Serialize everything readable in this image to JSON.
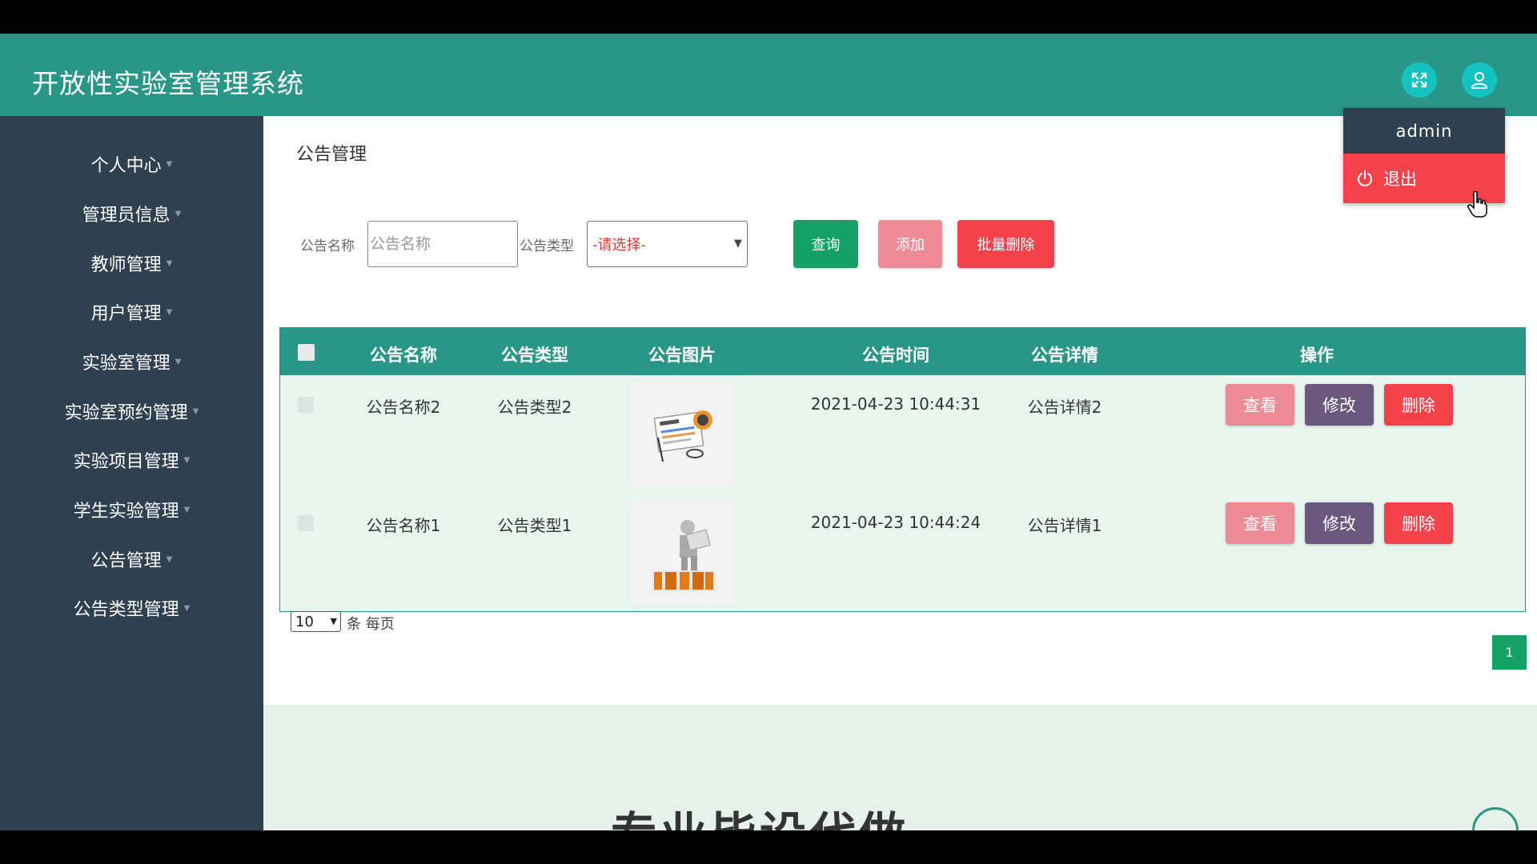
{
  "header": {
    "app_title": "开放性实验室管理系统",
    "colors": {
      "topbar": "#2a9688",
      "icon_button": "#14c2c2"
    },
    "icons": [
      "expand-icon",
      "user-icon"
    ]
  },
  "sidebar": {
    "items": [
      {
        "label": "个人中心"
      },
      {
        "label": "管理员信息"
      },
      {
        "label": "教师管理"
      },
      {
        "label": "用户管理"
      },
      {
        "label": "实验室管理"
      },
      {
        "label": "实验室预约管理"
      },
      {
        "label": "实验项目管理"
      },
      {
        "label": "学生实验管理"
      },
      {
        "label": "公告管理"
      },
      {
        "label": "公告类型管理"
      }
    ]
  },
  "page": {
    "title": "公告管理"
  },
  "search": {
    "name_label": "公告名称",
    "name_placeholder": "公告名称",
    "type_label": "公告类型",
    "type_selected": "-请选择-",
    "query_button": "查询",
    "add_button": "添加",
    "batch_delete_button": "批量删除"
  },
  "table": {
    "headers": {
      "name": "公告名称",
      "type": "公告类型",
      "image": "公告图片",
      "time": "公告时间",
      "detail": "公告详情",
      "actions": "操作"
    },
    "rows": [
      {
        "name": "公告名称2",
        "type": "公告类型2",
        "time": "2021-04-23 10:44:31",
        "detail": "公告详情2",
        "view": "查看",
        "edit": "修改",
        "delete": "删除"
      },
      {
        "name": "公告名称1",
        "type": "公告类型1",
        "time": "2021-04-23 10:44:24",
        "detail": "公告详情1",
        "view": "查看",
        "edit": "修改",
        "delete": "删除"
      }
    ]
  },
  "pagination": {
    "page_size": "10",
    "per_page_text": "条 每页",
    "current_page": "1"
  },
  "footer": {
    "watermark": "专业毕设代做"
  },
  "user_menu": {
    "username": "admin",
    "logout": "退出"
  }
}
